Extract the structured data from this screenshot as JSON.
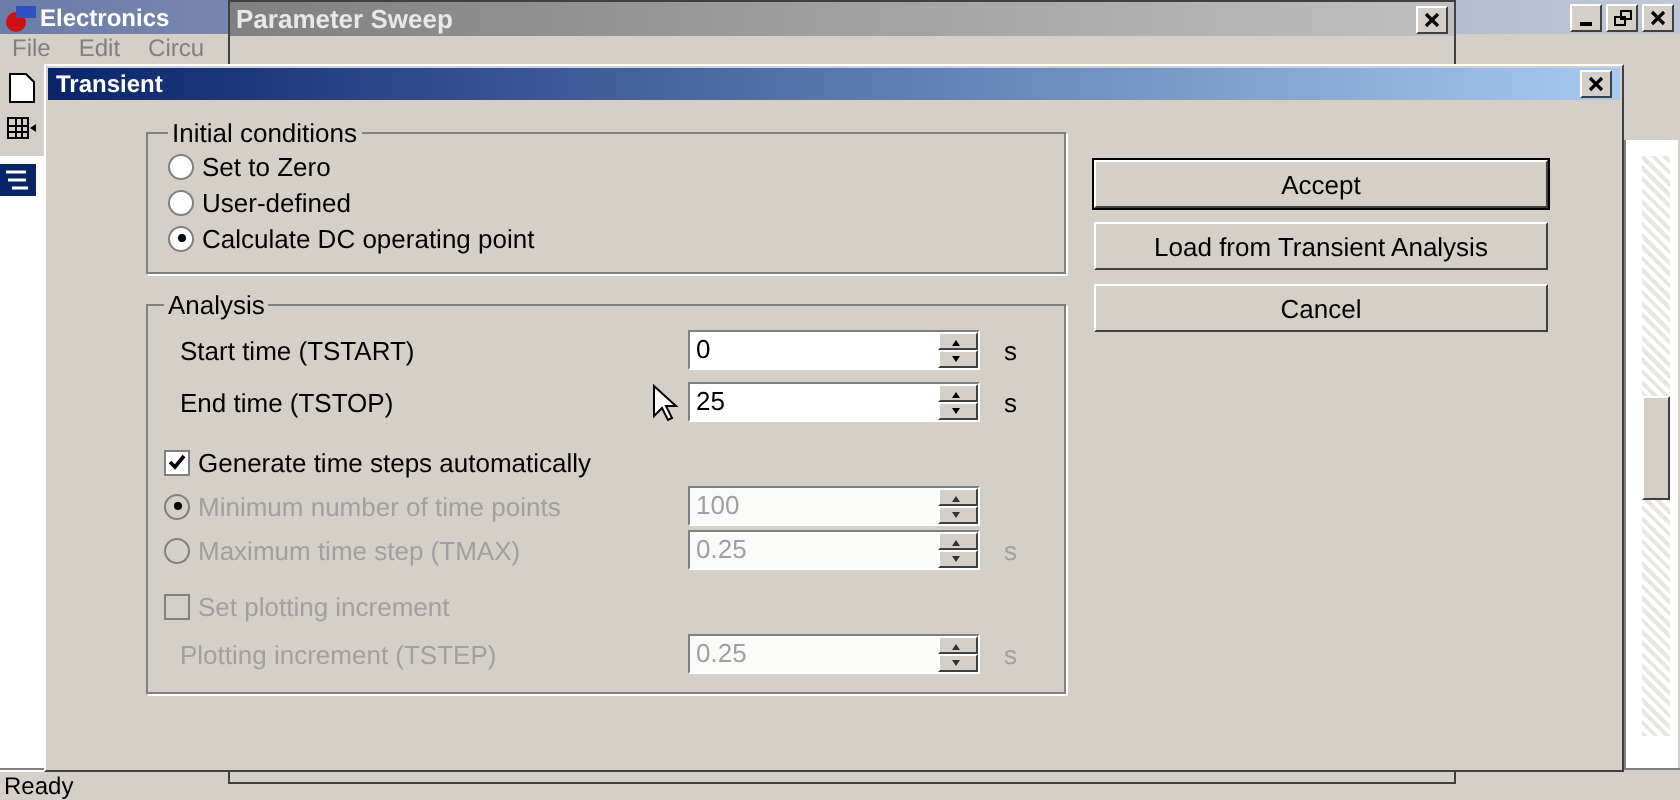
{
  "app_window": {
    "title": "Electronics",
    "menu": [
      "File",
      "Edit",
      "Circu"
    ],
    "status_bar": "Ready"
  },
  "background_dialog": {
    "title": "Parameter Sweep"
  },
  "dialog": {
    "title": "Transient",
    "initial_conditions": {
      "title": "Initial conditions",
      "options": [
        {
          "label": "Set to Zero",
          "selected": false
        },
        {
          "label": "User-defined",
          "selected": false
        },
        {
          "label": "Calculate DC operating point",
          "selected": true
        }
      ]
    },
    "analysis": {
      "title": "Analysis",
      "rows": [
        {
          "kind": "field",
          "label": "Start time (TSTART)",
          "value": "0",
          "unit": "s",
          "disabled": false
        },
        {
          "kind": "field",
          "label": "End time (TSTOP)",
          "value": "25",
          "unit": "s",
          "disabled": false
        },
        {
          "kind": "checkbox",
          "label": "Generate time steps automatically",
          "checked": true,
          "disabled": false
        },
        {
          "kind": "radio",
          "label": "Minimum number of time points",
          "selected": true,
          "value": "100",
          "disabled": true
        },
        {
          "kind": "radio",
          "label": "Maximum time step (TMAX)",
          "selected": false,
          "value": "0.25",
          "unit": "s",
          "disabled": true
        },
        {
          "kind": "checkbox",
          "label": "Set plotting increment",
          "checked": false,
          "disabled": true
        },
        {
          "kind": "field",
          "label": "Plotting increment (TSTEP)",
          "value": "0.25",
          "unit": "s",
          "disabled": true
        }
      ]
    },
    "buttons": [
      {
        "label": "Accept",
        "default": true
      },
      {
        "label": "Load from Transient Analysis",
        "default": false
      },
      {
        "label": "Cancel",
        "default": false
      }
    ]
  }
}
